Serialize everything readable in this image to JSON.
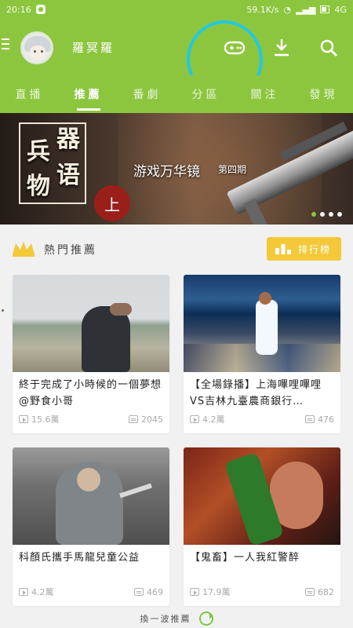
{
  "status": {
    "time": "20:16",
    "network_speed": "59.1K/s",
    "network_type": "4G"
  },
  "header": {
    "username": "羅冥羅"
  },
  "tabs": [
    "直播",
    "推薦",
    "番劇",
    "分區",
    "關注",
    "發現"
  ],
  "banner": {
    "line1": "兵",
    "line2": "器",
    "line3": "物",
    "line4": "语",
    "seal": "上",
    "subtitle": "游戏万华镜",
    "issue": "第四期"
  },
  "section": {
    "title": "熱門推薦",
    "rank_label": "排行榜"
  },
  "videos": [
    {
      "title": "終于完成了小時候的一個夢想@野食小哥",
      "views": "15.6萬",
      "danmaku": "2045"
    },
    {
      "title": "【全場錄播】上海嗶哩嗶哩VS吉林九臺農商銀行…",
      "views": "4.2萬",
      "danmaku": "476"
    },
    {
      "title": "科顏氏攜手馬龍兒童公益",
      "views": "4.2萬",
      "danmaku": "469"
    },
    {
      "title": "【鬼畜】一人我紅警醉",
      "views": "17.9萬",
      "danmaku": "682"
    }
  ],
  "footer": {
    "refresh_label": "換一波推薦"
  },
  "colors": {
    "brand": "#8cc63f",
    "rank": "#f3c93a",
    "annotation": "#23c8df"
  }
}
